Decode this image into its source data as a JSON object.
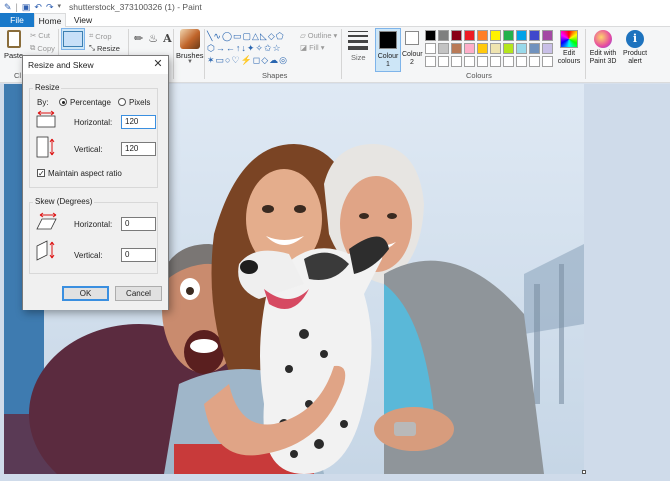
{
  "app": {
    "title": "shutterstock_373100326 (1) - Paint",
    "quick_access": [
      "save",
      "undo",
      "redo"
    ]
  },
  "tabs": [
    {
      "label": "File"
    },
    {
      "label": "Home"
    },
    {
      "label": "View"
    }
  ],
  "ribbon": {
    "clipboard": {
      "paste": "Paste",
      "cut": "Cut",
      "copy": "Copy",
      "group_label": "Cl"
    },
    "image": {
      "crop": "Crop",
      "resize": "Resize"
    },
    "brushes": "Brushes",
    "shapes": {
      "outline": "Outline",
      "fill": "Fill",
      "group_label": "Shapes"
    },
    "size": "Size",
    "colour1": "Colour 1",
    "colour2": "Colour 2",
    "colours_group_label": "Colours",
    "edit_colours": "Edit colours",
    "edit_paint3d": "Edit with Paint 3D",
    "product_alert": "Product alert",
    "palette": [
      "#000000",
      "#7f7f7f",
      "#880015",
      "#ed1c24",
      "#ff7f27",
      "#fff200",
      "#22b14c",
      "#00a2e8",
      "#3f48cc",
      "#a349a4",
      "#ffffff",
      "#c3c3c3",
      "#b97a57",
      "#ffaec9",
      "#ffc90e",
      "#efe4b0",
      "#b5e61d",
      "#99d9ea",
      "#7092be",
      "#c8bfe7",
      "#ffffff",
      "#ffffff",
      "#ffffff",
      "#ffffff",
      "#ffffff",
      "#ffffff",
      "#ffffff",
      "#ffffff",
      "#ffffff",
      "#ffffff"
    ]
  },
  "dialog": {
    "title": "Resize and Skew",
    "close": "✕",
    "resize": {
      "legend": "Resize",
      "by_label": "By:",
      "percentage": "Percentage",
      "pixels": "Pixels",
      "selected": "Percentage",
      "horizontal_label": "Horizontal:",
      "horizontal_value": "120",
      "vertical_label": "Vertical:",
      "vertical_value": "120",
      "maintain_aspect": "Maintain aspect ratio",
      "maintain_checked": true
    },
    "skew": {
      "legend": "Skew (Degrees)",
      "horizontal_label": "Horizontal:",
      "horizontal_value": "0",
      "vertical_label": "Vertical:",
      "vertical_value": "0"
    },
    "ok": "OK",
    "cancel": "Cancel"
  }
}
